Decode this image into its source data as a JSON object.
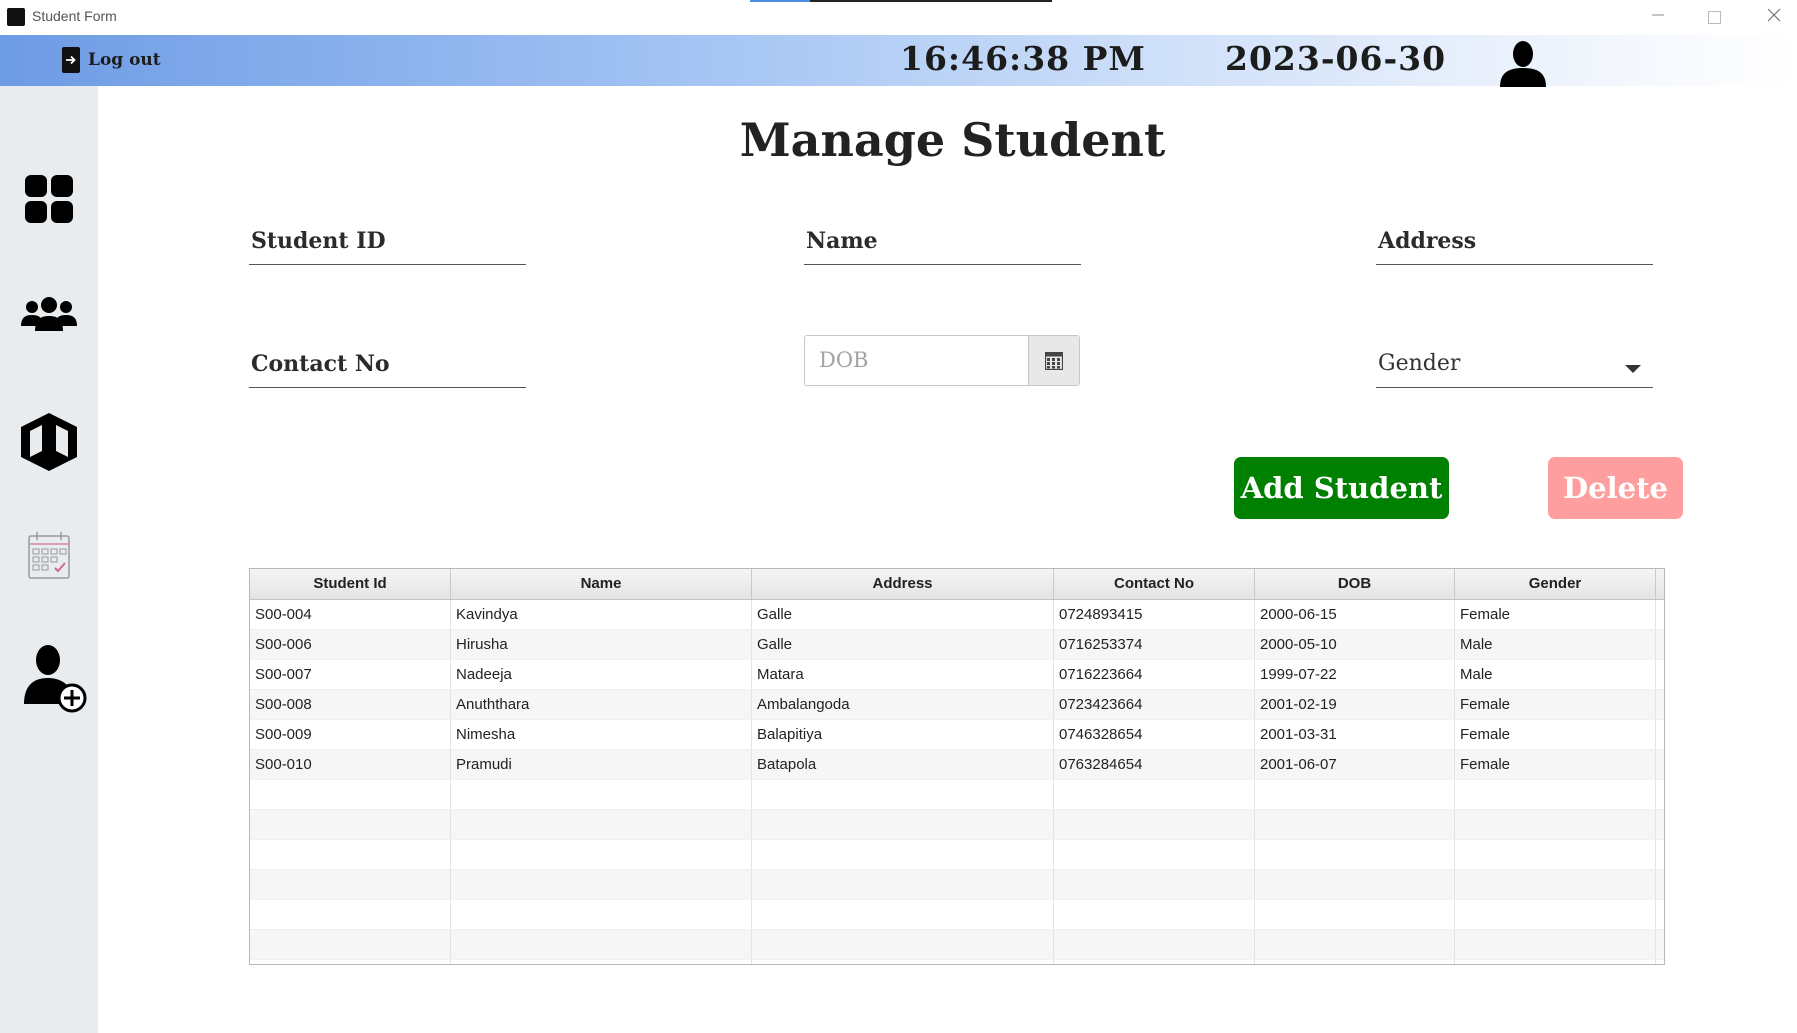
{
  "window": {
    "title": "Student Form"
  },
  "header": {
    "logout_label": "Log out",
    "time": "16:46:38 PM",
    "date": "2023-06-30"
  },
  "page": {
    "title": "Manage Student"
  },
  "form": {
    "student_id_label": "Student ID",
    "name_label": "Name",
    "address_label": "Address",
    "contact_label": "Contact No",
    "dob_placeholder": "DOB",
    "gender_label": "Gender",
    "add_button": "Add Student",
    "delete_button": "Delete"
  },
  "table": {
    "columns": [
      "Student Id",
      "Name",
      "Address",
      "Contact No",
      "DOB",
      "Gender"
    ],
    "rows": [
      [
        "S00-004",
        "Kavindya",
        "Galle",
        "0724893415",
        "2000-06-15",
        "Female"
      ],
      [
        "S00-006",
        "Hirusha",
        "Galle",
        "0716253374",
        "2000-05-10",
        "Male"
      ],
      [
        "S00-007",
        "Nadeeja",
        "Matara",
        "0716223664",
        "1999-07-22",
        "Male"
      ],
      [
        "S00-008",
        "Anuththara",
        "Ambalangoda",
        "0723423664",
        "2001-02-19",
        "Female"
      ],
      [
        "S00-009",
        "Nimesha",
        "Balapitiya",
        "0746328654",
        "2001-03-31",
        "Female"
      ],
      [
        "S00-010",
        "Pramudi",
        "Batapola",
        "0763284654",
        "2001-06-07",
        "Female"
      ],
      [
        "",
        "",
        "",
        "",
        "",
        ""
      ],
      [
        "",
        "",
        "",
        "",
        "",
        ""
      ],
      [
        "",
        "",
        "",
        "",
        "",
        ""
      ],
      [
        "",
        "",
        "",
        "",
        "",
        ""
      ],
      [
        "",
        "",
        "",
        "",
        "",
        ""
      ],
      [
        "",
        "",
        "",
        "",
        "",
        ""
      ],
      [
        "",
        "",
        "",
        "",
        "",
        ""
      ]
    ]
  },
  "colors": {
    "add": "#008000",
    "delete": "#ff9e9e",
    "sidebar": "#e9ecef"
  },
  "icons": {
    "dashboard": "dashboard-icon",
    "students": "users-group-icon",
    "subjects": "cube-icon",
    "schedule": "calendar-icon",
    "add_student": "user-add-icon"
  }
}
